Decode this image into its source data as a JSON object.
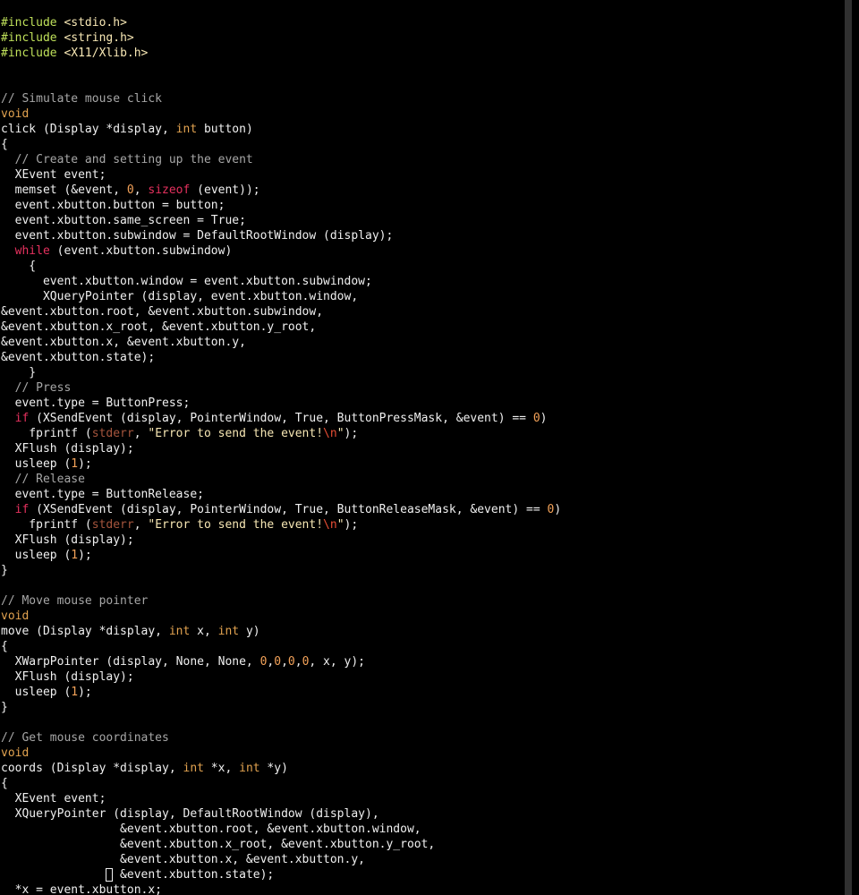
{
  "colors": {
    "background": "#000000",
    "text": "#f0f0f0",
    "preprocessor": "#bfe05a",
    "string": "#f7e7b4",
    "comment": "#a7a7a7",
    "type": "#e2a350",
    "keyword": "#e5315e",
    "number": "#f3a259",
    "escape": "#e84d34",
    "stream": "#a5553d",
    "scrollbar_track": "#303030"
  },
  "editor": {
    "cursor": {
      "line": 56,
      "column": 15
    },
    "lines": [
      [
        [
          "preproc",
          "#include "
        ],
        [
          "string",
          "<stdio.h>"
        ]
      ],
      [
        [
          "preproc",
          "#include "
        ],
        [
          "string",
          "<string.h>"
        ]
      ],
      [
        [
          "preproc",
          "#include "
        ],
        [
          "string",
          "<X11/Xlib.h>"
        ]
      ],
      [],
      [],
      [
        [
          "comment",
          "// Simulate mouse click"
        ]
      ],
      [
        [
          "type",
          "void"
        ]
      ],
      [
        [
          "text",
          "click (Display *display, "
        ],
        [
          "type",
          "int"
        ],
        [
          "text",
          " button)"
        ]
      ],
      [
        [
          "text",
          "{"
        ]
      ],
      [
        [
          "text",
          "  "
        ],
        [
          "comment",
          "// Create and setting up the event"
        ]
      ],
      [
        [
          "text",
          "  XEvent event;"
        ]
      ],
      [
        [
          "text",
          "  memset (&event, "
        ],
        [
          "number",
          "0"
        ],
        [
          "text",
          ", "
        ],
        [
          "keyword",
          "sizeof"
        ],
        [
          "text",
          " (event));"
        ]
      ],
      [
        [
          "text",
          "  event.xbutton.button = button;"
        ]
      ],
      [
        [
          "text",
          "  event.xbutton.same_screen = True;"
        ]
      ],
      [
        [
          "text",
          "  event.xbutton.subwindow = DefaultRootWindow (display);"
        ]
      ],
      [
        [
          "text",
          "  "
        ],
        [
          "keyword",
          "while"
        ],
        [
          "text",
          " (event.xbutton.subwindow)"
        ]
      ],
      [
        [
          "text",
          "    {"
        ]
      ],
      [
        [
          "text",
          "      event.xbutton.window = event.xbutton.subwindow;"
        ]
      ],
      [
        [
          "text",
          "      XQueryPointer (display, event.xbutton.window,"
        ]
      ],
      [
        [
          "text",
          "&event.xbutton.root, &event.xbutton.subwindow,"
        ]
      ],
      [
        [
          "text",
          "&event.xbutton.x_root, &event.xbutton.y_root,"
        ]
      ],
      [
        [
          "text",
          "&event.xbutton.x, &event.xbutton.y,"
        ]
      ],
      [
        [
          "text",
          "&event.xbutton.state);"
        ]
      ],
      [
        [
          "text",
          "    }"
        ]
      ],
      [
        [
          "text",
          "  "
        ],
        [
          "comment",
          "// Press"
        ]
      ],
      [
        [
          "text",
          "  event.type = ButtonPress;"
        ]
      ],
      [
        [
          "text",
          "  "
        ],
        [
          "keyword",
          "if"
        ],
        [
          "text",
          " (XSendEvent (display, PointerWindow, True, ButtonPressMask, &event) == "
        ],
        [
          "number",
          "0"
        ],
        [
          "text",
          ")"
        ]
      ],
      [
        [
          "text",
          "    fprintf ("
        ],
        [
          "stream",
          "stderr"
        ],
        [
          "text",
          ", "
        ],
        [
          "string",
          "\"Error to send the event!"
        ],
        [
          "escape",
          "\\n"
        ],
        [
          "string",
          "\""
        ],
        [
          "text",
          ");"
        ]
      ],
      [
        [
          "text",
          "  XFlush (display);"
        ]
      ],
      [
        [
          "text",
          "  usleep ("
        ],
        [
          "number",
          "1"
        ],
        [
          "text",
          ");"
        ]
      ],
      [
        [
          "text",
          "  "
        ],
        [
          "comment",
          "// Release"
        ]
      ],
      [
        [
          "text",
          "  event.type = ButtonRelease;"
        ]
      ],
      [
        [
          "text",
          "  "
        ],
        [
          "keyword",
          "if"
        ],
        [
          "text",
          " (XSendEvent (display, PointerWindow, True, ButtonReleaseMask, &event) == "
        ],
        [
          "number",
          "0"
        ],
        [
          "text",
          ")"
        ]
      ],
      [
        [
          "text",
          "    fprintf ("
        ],
        [
          "stream",
          "stderr"
        ],
        [
          "text",
          ", "
        ],
        [
          "string",
          "\"Error to send the event!"
        ],
        [
          "escape",
          "\\n"
        ],
        [
          "string",
          "\""
        ],
        [
          "text",
          ");"
        ]
      ],
      [
        [
          "text",
          "  XFlush (display);"
        ]
      ],
      [
        [
          "text",
          "  usleep ("
        ],
        [
          "number",
          "1"
        ],
        [
          "text",
          ");"
        ]
      ],
      [
        [
          "text",
          "}"
        ]
      ],
      [],
      [
        [
          "comment",
          "// Move mouse pointer"
        ]
      ],
      [
        [
          "type",
          "void"
        ]
      ],
      [
        [
          "text",
          "move (Display *display, "
        ],
        [
          "type",
          "int"
        ],
        [
          "text",
          " x, "
        ],
        [
          "type",
          "int"
        ],
        [
          "text",
          " y)"
        ]
      ],
      [
        [
          "text",
          "{"
        ]
      ],
      [
        [
          "text",
          "  XWarpPointer (display, None, None, "
        ],
        [
          "number",
          "0"
        ],
        [
          "text",
          ","
        ],
        [
          "number",
          "0"
        ],
        [
          "text",
          ","
        ],
        [
          "number",
          "0"
        ],
        [
          "text",
          ","
        ],
        [
          "number",
          "0"
        ],
        [
          "text",
          ", x, y);"
        ]
      ],
      [
        [
          "text",
          "  XFlush (display);"
        ]
      ],
      [
        [
          "text",
          "  usleep ("
        ],
        [
          "number",
          "1"
        ],
        [
          "text",
          ");"
        ]
      ],
      [
        [
          "text",
          "}"
        ]
      ],
      [],
      [
        [
          "comment",
          "// Get mouse coordinates"
        ]
      ],
      [
        [
          "type",
          "void"
        ]
      ],
      [
        [
          "text",
          "coords (Display *display, "
        ],
        [
          "type",
          "int"
        ],
        [
          "text",
          " *x, "
        ],
        [
          "type",
          "int"
        ],
        [
          "text",
          " *y)"
        ]
      ],
      [
        [
          "text",
          "{"
        ]
      ],
      [
        [
          "text",
          "  XEvent event;"
        ]
      ],
      [
        [
          "text",
          "  XQueryPointer (display, DefaultRootWindow (display),"
        ]
      ],
      [
        [
          "text",
          "                 &event.xbutton.root, &event.xbutton.window,"
        ]
      ],
      [
        [
          "text",
          "                 &event.xbutton.x_root, &event.xbutton.y_root,"
        ]
      ],
      [
        [
          "text",
          "                 &event.xbutton.x, &event.xbutton.y,"
        ]
      ],
      [
        [
          "text",
          "                 &event.xbutton.state);"
        ]
      ],
      [
        [
          "text",
          "  *x = event.xbutton.x;"
        ]
      ]
    ]
  }
}
